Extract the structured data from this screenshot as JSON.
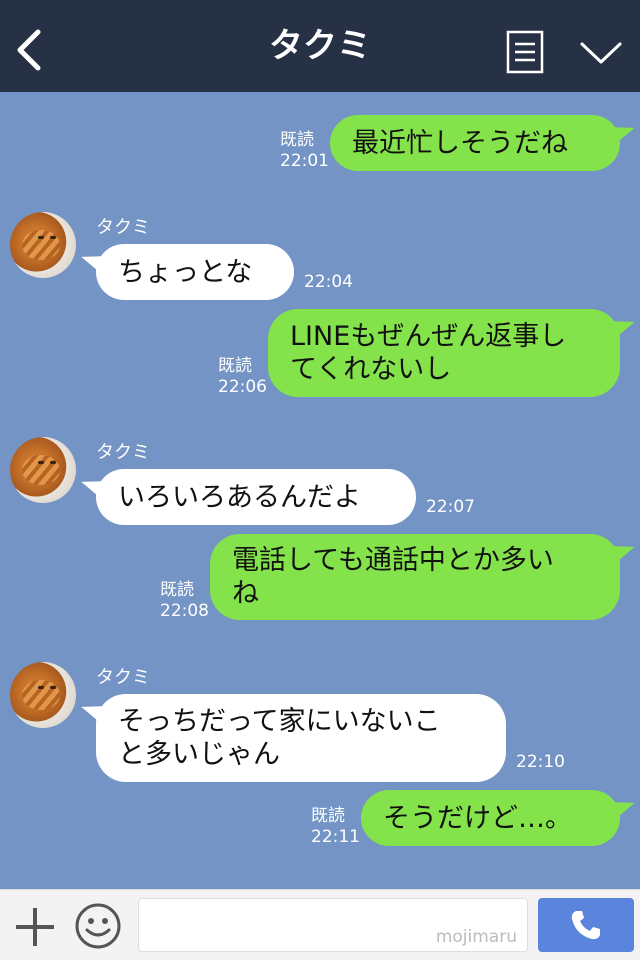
{
  "header": {
    "title": "タクミ"
  },
  "messages": [
    {
      "text": "最近忙しそうだね",
      "read": "既読",
      "time": "22:01"
    },
    {
      "name": "タクミ",
      "text": "ちょっとな",
      "time": "22:04"
    },
    {
      "lines": [
        "LINEもぜんぜん返事し",
        "てくれないし"
      ],
      "read": "既読",
      "time": "22:06"
    },
    {
      "name": "タクミ",
      "text": "いろいろあるんだよ",
      "time": "22:07"
    },
    {
      "lines": [
        "電話しても通話中とか多い",
        "ね"
      ],
      "read": "既読",
      "time": "22:08"
    },
    {
      "name": "タクミ",
      "lines": [
        "そっちだって家にいないこ",
        "と多いじゃん"
      ],
      "time": "22:10"
    },
    {
      "text": "そうだけど…。",
      "read": "既読",
      "time": "22:11"
    }
  ],
  "footer": {
    "watermark": "mojimaru"
  },
  "colors": {
    "header": "#263145",
    "background": "#7394c4",
    "my_bubble": "#84e34a",
    "their_bubble": "#ffffff",
    "call_button": "#5b85dd"
  },
  "icons": [
    "back-icon",
    "menu-icon",
    "chevron-down-icon",
    "plus-icon",
    "emoji-icon",
    "phone-icon"
  ]
}
